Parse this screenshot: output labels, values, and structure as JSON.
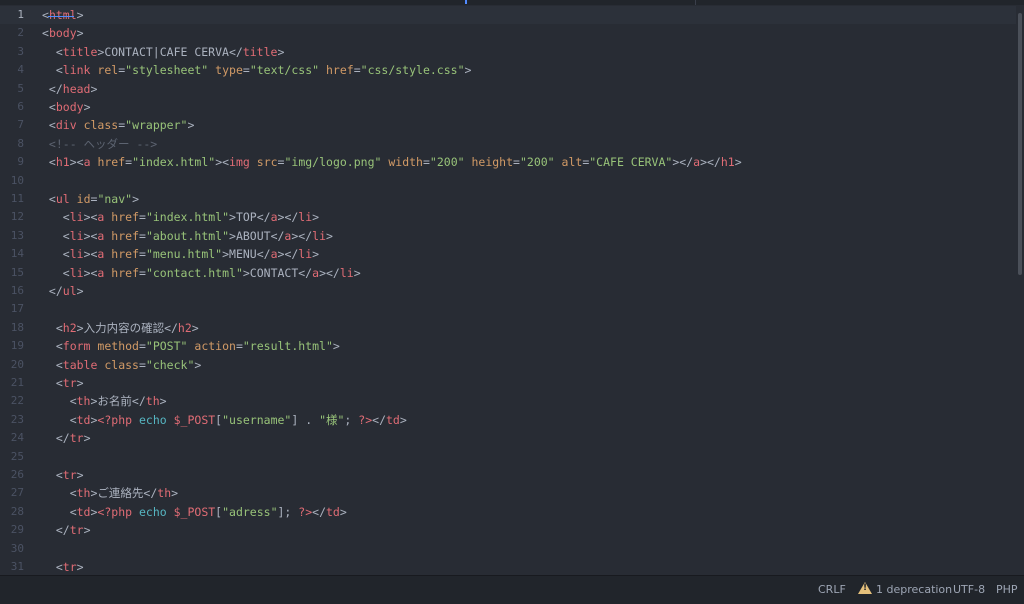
{
  "colors": {
    "background": "#282c34",
    "tag": "#e06c75",
    "attribute": "#d19a66",
    "string": "#98c379",
    "comment": "#5c6370",
    "keyword": "#56b6c2",
    "text": "#abb2bf",
    "line_number": "#4b5263",
    "warning": "#e5c07b"
  },
  "editor": {
    "current_line": 1,
    "lines": [
      {
        "n": "1",
        "tokens": [
          {
            "t": "<",
            "c": "text"
          },
          {
            "t": "html",
            "c": "tag"
          },
          {
            "t": ">",
            "c": "text"
          }
        ]
      },
      {
        "n": "2",
        "tokens": [
          {
            "t": "<",
            "c": "text"
          },
          {
            "t": "body",
            "c": "tag"
          },
          {
            "t": ">",
            "c": "text"
          }
        ]
      },
      {
        "n": "3",
        "tokens": [
          {
            "t": "  <",
            "c": "text"
          },
          {
            "t": "title",
            "c": "tag"
          },
          {
            "t": ">CONTACT|CAFE CERVA</",
            "c": "text"
          },
          {
            "t": "title",
            "c": "tag"
          },
          {
            "t": ">",
            "c": "text"
          }
        ]
      },
      {
        "n": "4",
        "tokens": [
          {
            "t": "  <",
            "c": "text"
          },
          {
            "t": "link",
            "c": "tag"
          },
          {
            "t": " ",
            "c": "text"
          },
          {
            "t": "rel",
            "c": "attribute"
          },
          {
            "t": "=",
            "c": "text"
          },
          {
            "t": "\"stylesheet\"",
            "c": "string"
          },
          {
            "t": " ",
            "c": "text"
          },
          {
            "t": "type",
            "c": "attribute"
          },
          {
            "t": "=",
            "c": "text"
          },
          {
            "t": "\"text/css\"",
            "c": "string"
          },
          {
            "t": " ",
            "c": "text"
          },
          {
            "t": "href",
            "c": "attribute"
          },
          {
            "t": "=",
            "c": "text"
          },
          {
            "t": "\"css/style.css\"",
            "c": "string"
          },
          {
            "t": ">",
            "c": "text"
          }
        ]
      },
      {
        "n": "5",
        "tokens": [
          {
            "t": " </",
            "c": "text"
          },
          {
            "t": "head",
            "c": "tag"
          },
          {
            "t": ">",
            "c": "text"
          }
        ]
      },
      {
        "n": "6",
        "tokens": [
          {
            "t": " <",
            "c": "text"
          },
          {
            "t": "body",
            "c": "tag"
          },
          {
            "t": ">",
            "c": "text"
          }
        ]
      },
      {
        "n": "7",
        "tokens": [
          {
            "t": " <",
            "c": "text"
          },
          {
            "t": "div",
            "c": "tag"
          },
          {
            "t": " ",
            "c": "text"
          },
          {
            "t": "class",
            "c": "attribute"
          },
          {
            "t": "=",
            "c": "text"
          },
          {
            "t": "\"wrapper\"",
            "c": "string"
          },
          {
            "t": ">",
            "c": "text"
          }
        ]
      },
      {
        "n": "8",
        "tokens": [
          {
            "t": " <!-- ヘッダー -->",
            "c": "comment"
          }
        ]
      },
      {
        "n": "9",
        "tokens": [
          {
            "t": " <",
            "c": "text"
          },
          {
            "t": "h1",
            "c": "tag"
          },
          {
            "t": "><",
            "c": "text"
          },
          {
            "t": "a",
            "c": "tag"
          },
          {
            "t": " ",
            "c": "text"
          },
          {
            "t": "href",
            "c": "attribute"
          },
          {
            "t": "=",
            "c": "text"
          },
          {
            "t": "\"index.html\"",
            "c": "string"
          },
          {
            "t": "><",
            "c": "text"
          },
          {
            "t": "img",
            "c": "tag"
          },
          {
            "t": " ",
            "c": "text"
          },
          {
            "t": "src",
            "c": "attribute"
          },
          {
            "t": "=",
            "c": "text"
          },
          {
            "t": "\"img/logo.png\"",
            "c": "string"
          },
          {
            "t": " ",
            "c": "text"
          },
          {
            "t": "width",
            "c": "attribute"
          },
          {
            "t": "=",
            "c": "text"
          },
          {
            "t": "\"200\"",
            "c": "string"
          },
          {
            "t": " ",
            "c": "text"
          },
          {
            "t": "height",
            "c": "attribute"
          },
          {
            "t": "=",
            "c": "text"
          },
          {
            "t": "\"200\"",
            "c": "string"
          },
          {
            "t": " ",
            "c": "text"
          },
          {
            "t": "alt",
            "c": "attribute"
          },
          {
            "t": "=",
            "c": "text"
          },
          {
            "t": "\"CAFE CERVA\"",
            "c": "string"
          },
          {
            "t": "></",
            "c": "text"
          },
          {
            "t": "a",
            "c": "tag"
          },
          {
            "t": "></",
            "c": "text"
          },
          {
            "t": "h1",
            "c": "tag"
          },
          {
            "t": ">",
            "c": "text"
          }
        ]
      },
      {
        "n": "10",
        "tokens": []
      },
      {
        "n": "11",
        "tokens": [
          {
            "t": " <",
            "c": "text"
          },
          {
            "t": "ul",
            "c": "tag"
          },
          {
            "t": " ",
            "c": "text"
          },
          {
            "t": "id",
            "c": "attribute"
          },
          {
            "t": "=",
            "c": "text"
          },
          {
            "t": "\"nav\"",
            "c": "string"
          },
          {
            "t": ">",
            "c": "text"
          }
        ]
      },
      {
        "n": "12",
        "tokens": [
          {
            "t": "   <",
            "c": "text"
          },
          {
            "t": "li",
            "c": "tag"
          },
          {
            "t": "><",
            "c": "text"
          },
          {
            "t": "a",
            "c": "tag"
          },
          {
            "t": " ",
            "c": "text"
          },
          {
            "t": "href",
            "c": "attribute"
          },
          {
            "t": "=",
            "c": "text"
          },
          {
            "t": "\"index.html\"",
            "c": "string"
          },
          {
            "t": ">TOP</",
            "c": "text"
          },
          {
            "t": "a",
            "c": "tag"
          },
          {
            "t": "></",
            "c": "text"
          },
          {
            "t": "li",
            "c": "tag"
          },
          {
            "t": ">",
            "c": "text"
          }
        ]
      },
      {
        "n": "13",
        "tokens": [
          {
            "t": "   <",
            "c": "text"
          },
          {
            "t": "li",
            "c": "tag"
          },
          {
            "t": "><",
            "c": "text"
          },
          {
            "t": "a",
            "c": "tag"
          },
          {
            "t": " ",
            "c": "text"
          },
          {
            "t": "href",
            "c": "attribute"
          },
          {
            "t": "=",
            "c": "text"
          },
          {
            "t": "\"about.html\"",
            "c": "string"
          },
          {
            "t": ">ABOUT</",
            "c": "text"
          },
          {
            "t": "a",
            "c": "tag"
          },
          {
            "t": "></",
            "c": "text"
          },
          {
            "t": "li",
            "c": "tag"
          },
          {
            "t": ">",
            "c": "text"
          }
        ]
      },
      {
        "n": "14",
        "tokens": [
          {
            "t": "   <",
            "c": "text"
          },
          {
            "t": "li",
            "c": "tag"
          },
          {
            "t": "><",
            "c": "text"
          },
          {
            "t": "a",
            "c": "tag"
          },
          {
            "t": " ",
            "c": "text"
          },
          {
            "t": "href",
            "c": "attribute"
          },
          {
            "t": "=",
            "c": "text"
          },
          {
            "t": "\"menu.html\"",
            "c": "string"
          },
          {
            "t": ">MENU</",
            "c": "text"
          },
          {
            "t": "a",
            "c": "tag"
          },
          {
            "t": "></",
            "c": "text"
          },
          {
            "t": "li",
            "c": "tag"
          },
          {
            "t": ">",
            "c": "text"
          }
        ]
      },
      {
        "n": "15",
        "tokens": [
          {
            "t": "   <",
            "c": "text"
          },
          {
            "t": "li",
            "c": "tag"
          },
          {
            "t": "><",
            "c": "text"
          },
          {
            "t": "a",
            "c": "tag"
          },
          {
            "t": " ",
            "c": "text"
          },
          {
            "t": "href",
            "c": "attribute"
          },
          {
            "t": "=",
            "c": "text"
          },
          {
            "t": "\"contact.html\"",
            "c": "string"
          },
          {
            "t": ">CONTACT</",
            "c": "text"
          },
          {
            "t": "a",
            "c": "tag"
          },
          {
            "t": "></",
            "c": "text"
          },
          {
            "t": "li",
            "c": "tag"
          },
          {
            "t": ">",
            "c": "text"
          }
        ]
      },
      {
        "n": "16",
        "tokens": [
          {
            "t": " </",
            "c": "text"
          },
          {
            "t": "ul",
            "c": "tag"
          },
          {
            "t": ">",
            "c": "text"
          }
        ]
      },
      {
        "n": "17",
        "tokens": []
      },
      {
        "n": "18",
        "tokens": [
          {
            "t": "  <",
            "c": "text"
          },
          {
            "t": "h2",
            "c": "tag"
          },
          {
            "t": ">入力内容の確認</",
            "c": "text"
          },
          {
            "t": "h2",
            "c": "tag"
          },
          {
            "t": ">",
            "c": "text"
          }
        ]
      },
      {
        "n": "19",
        "tokens": [
          {
            "t": "  <",
            "c": "text"
          },
          {
            "t": "form",
            "c": "tag"
          },
          {
            "t": " ",
            "c": "text"
          },
          {
            "t": "method",
            "c": "attribute"
          },
          {
            "t": "=",
            "c": "text"
          },
          {
            "t": "\"POST\"",
            "c": "string"
          },
          {
            "t": " ",
            "c": "text"
          },
          {
            "t": "action",
            "c": "attribute"
          },
          {
            "t": "=",
            "c": "text"
          },
          {
            "t": "\"result.html\"",
            "c": "string"
          },
          {
            "t": ">",
            "c": "text"
          }
        ]
      },
      {
        "n": "20",
        "tokens": [
          {
            "t": "  <",
            "c": "text"
          },
          {
            "t": "table",
            "c": "tag"
          },
          {
            "t": " ",
            "c": "text"
          },
          {
            "t": "class",
            "c": "attribute"
          },
          {
            "t": "=",
            "c": "text"
          },
          {
            "t": "\"check\"",
            "c": "string"
          },
          {
            "t": ">",
            "c": "text"
          }
        ]
      },
      {
        "n": "21",
        "tokens": [
          {
            "t": "  <",
            "c": "text"
          },
          {
            "t": "tr",
            "c": "tag"
          },
          {
            "t": ">",
            "c": "text"
          }
        ]
      },
      {
        "n": "22",
        "tokens": [
          {
            "t": "    <",
            "c": "text"
          },
          {
            "t": "th",
            "c": "tag"
          },
          {
            "t": ">お名前</",
            "c": "text"
          },
          {
            "t": "th",
            "c": "tag"
          },
          {
            "t": ">",
            "c": "text"
          }
        ]
      },
      {
        "n": "23",
        "tokens": [
          {
            "t": "    <",
            "c": "text"
          },
          {
            "t": "td",
            "c": "tag"
          },
          {
            "t": ">",
            "c": "text"
          },
          {
            "t": "<?php",
            "c": "tag"
          },
          {
            "t": " ",
            "c": "text"
          },
          {
            "t": "echo",
            "c": "keyword"
          },
          {
            "t": " ",
            "c": "text"
          },
          {
            "t": "$_POST",
            "c": "tag"
          },
          {
            "t": "[",
            "c": "text"
          },
          {
            "t": "\"username\"",
            "c": "string"
          },
          {
            "t": "] . ",
            "c": "text"
          },
          {
            "t": "\"様\"",
            "c": "string"
          },
          {
            "t": "; ",
            "c": "text"
          },
          {
            "t": "?>",
            "c": "tag"
          },
          {
            "t": "</",
            "c": "text"
          },
          {
            "t": "td",
            "c": "tag"
          },
          {
            "t": ">",
            "c": "text"
          }
        ]
      },
      {
        "n": "24",
        "tokens": [
          {
            "t": "  </",
            "c": "text"
          },
          {
            "t": "tr",
            "c": "tag"
          },
          {
            "t": ">",
            "c": "text"
          }
        ]
      },
      {
        "n": "25",
        "tokens": []
      },
      {
        "n": "26",
        "tokens": [
          {
            "t": "  <",
            "c": "text"
          },
          {
            "t": "tr",
            "c": "tag"
          },
          {
            "t": ">",
            "c": "text"
          }
        ]
      },
      {
        "n": "27",
        "tokens": [
          {
            "t": "    <",
            "c": "text"
          },
          {
            "t": "th",
            "c": "tag"
          },
          {
            "t": ">ご連絡先</",
            "c": "text"
          },
          {
            "t": "th",
            "c": "tag"
          },
          {
            "t": ">",
            "c": "text"
          }
        ]
      },
      {
        "n": "28",
        "tokens": [
          {
            "t": "    <",
            "c": "text"
          },
          {
            "t": "td",
            "c": "tag"
          },
          {
            "t": ">",
            "c": "text"
          },
          {
            "t": "<?php",
            "c": "tag"
          },
          {
            "t": " ",
            "c": "text"
          },
          {
            "t": "echo",
            "c": "keyword"
          },
          {
            "t": " ",
            "c": "text"
          },
          {
            "t": "$_POST",
            "c": "tag"
          },
          {
            "t": "[",
            "c": "text"
          },
          {
            "t": "\"adress\"",
            "c": "string"
          },
          {
            "t": "]; ",
            "c": "text"
          },
          {
            "t": "?>",
            "c": "tag"
          },
          {
            "t": "</",
            "c": "text"
          },
          {
            "t": "td",
            "c": "tag"
          },
          {
            "t": ">",
            "c": "text"
          }
        ]
      },
      {
        "n": "29",
        "tokens": [
          {
            "t": "  </",
            "c": "text"
          },
          {
            "t": "tr",
            "c": "tag"
          },
          {
            "t": ">",
            "c": "text"
          }
        ]
      },
      {
        "n": "30",
        "tokens": []
      },
      {
        "n": "31",
        "tokens": [
          {
            "t": "  <",
            "c": "text"
          },
          {
            "t": "tr",
            "c": "tag"
          },
          {
            "t": ">",
            "c": "text"
          }
        ]
      }
    ]
  },
  "statusbar": {
    "line_ending": "CRLF",
    "deprecation": "1 deprecation",
    "warning_icon": "warning-icon",
    "encoding": "UTF-8",
    "grammar": "PHP"
  }
}
